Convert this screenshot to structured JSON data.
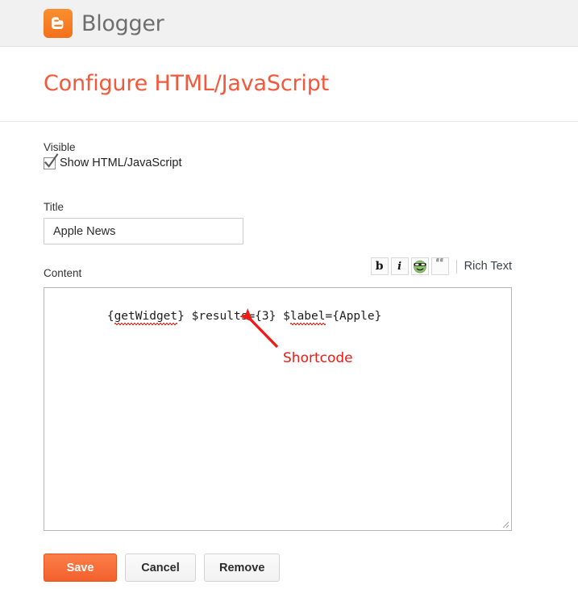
{
  "header": {
    "brand_name": "Blogger",
    "logo_icon": "blogger-b-icon"
  },
  "page_title": "Configure HTML/JavaScript",
  "form": {
    "visible": {
      "label": "Visible",
      "checkbox_label": "Show HTML/JavaScript",
      "checked": true,
      "check_icon": "checkmark-icon"
    },
    "title": {
      "label": "Title",
      "value": "Apple News",
      "placeholder": ""
    },
    "content": {
      "label": "Content",
      "value": "{getWidget} $results={3} $label={Apple}",
      "tokens": {
        "open_brace": "{",
        "get_widget": "getWidget",
        "mid": "} $results={3} $",
        "label_word": "label",
        "tail": "={Apple}"
      },
      "placeholder": ""
    },
    "toolbar": {
      "bold_label": "b",
      "bold_icon": "bold-icon",
      "italic_label": "i",
      "italic_icon": "italic-icon",
      "emoticon_icon": "smiley-sunglasses-icon",
      "quote_label": "“",
      "quote_icon": "blockquote-icon",
      "rich_text_label": "Rich Text"
    }
  },
  "annotation": {
    "label": "Shortcode",
    "color": "#ef1a14",
    "arrow_icon": "arrow-up-left-icon"
  },
  "buttons": {
    "save": "Save",
    "cancel": "Cancel",
    "remove": "Remove"
  },
  "colors": {
    "accent": "#f4583a",
    "brand_orange": "#f57d20",
    "header_bg": "#f1f1f1",
    "annotation_red": "#ef1a14"
  }
}
